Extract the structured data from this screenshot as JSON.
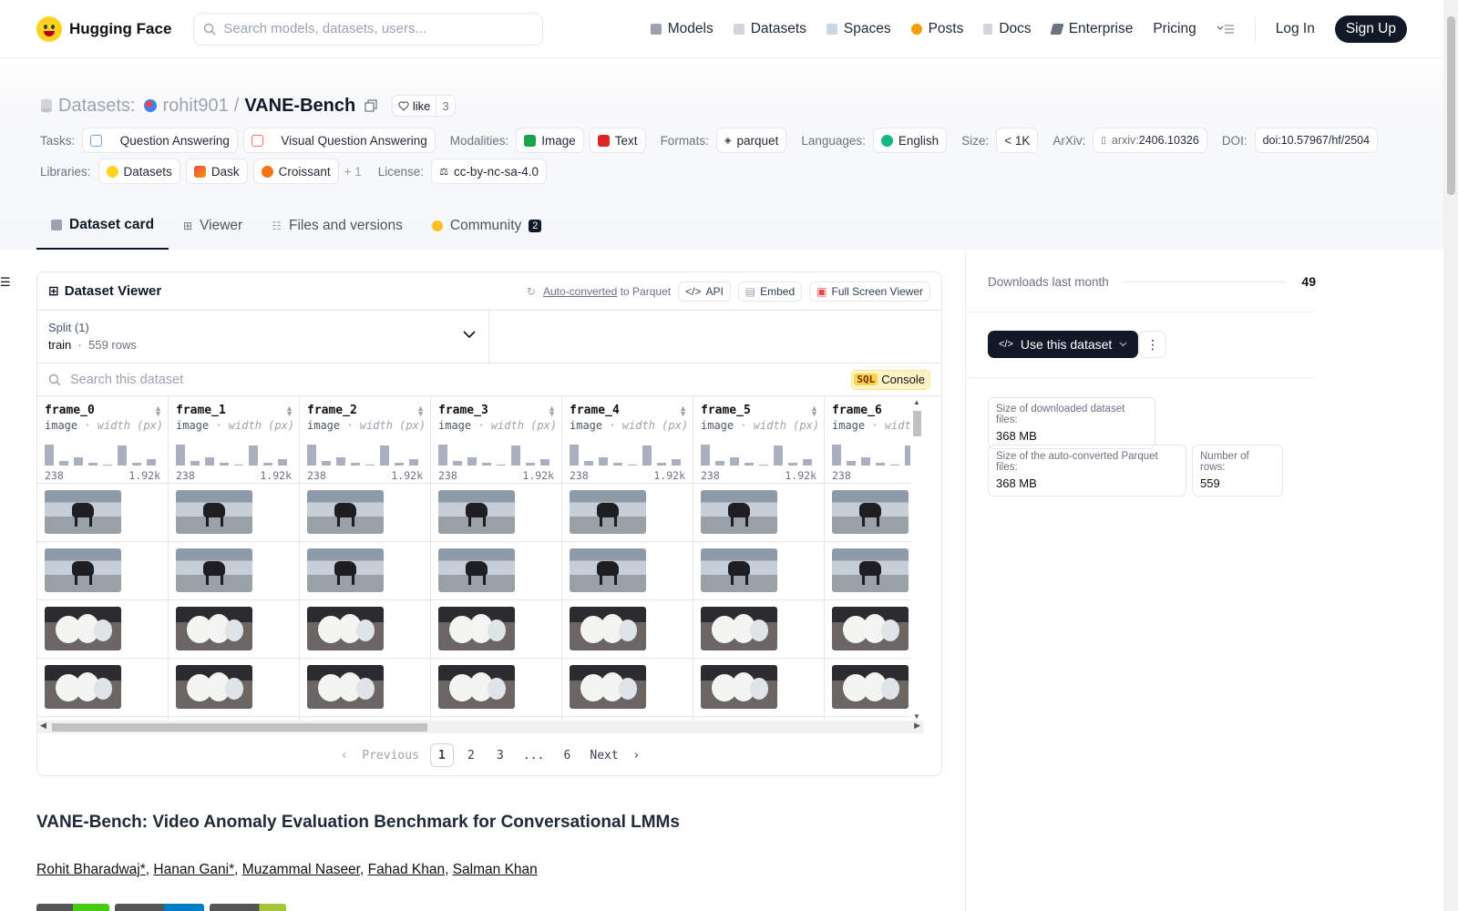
{
  "nav": {
    "brand": "Hugging Face",
    "search_placeholder": "Search models, datasets, users...",
    "links": [
      "Models",
      "Datasets",
      "Spaces",
      "Posts",
      "Docs",
      "Enterprise",
      "Pricing"
    ],
    "login": "Log In",
    "signup": "Sign Up"
  },
  "repo": {
    "type_label": "Datasets:",
    "owner": "rohit901",
    "slash": "/",
    "name": "VANE-Bench",
    "like_label": "like",
    "like_count": "3"
  },
  "tags": {
    "tasks_label": "Tasks:",
    "tasks": [
      "Question Answering",
      "Visual Question Answering"
    ],
    "modalities_label": "Modalities:",
    "modalities": [
      "Image",
      "Text"
    ],
    "formats_label": "Formats:",
    "format": "parquet",
    "languages_label": "Languages:",
    "language": "English",
    "size_label": "Size:",
    "size": "< 1K",
    "arxiv_label": "ArXiv:",
    "arxiv_prefix": "arxiv:",
    "arxiv_id": "2406.10326",
    "doi_label": "DOI:",
    "doi": "doi:10.57967/hf/2504",
    "libraries_label": "Libraries:",
    "libraries": [
      "Datasets",
      "Dask",
      "Croissant"
    ],
    "libraries_more": "+ 1",
    "license_label": "License:",
    "license": "cc-by-nc-sa-4.0"
  },
  "tabs": [
    "Dataset card",
    "Viewer",
    "Files and versions",
    "Community"
  ],
  "community_count": "2",
  "viewer": {
    "title": "Dataset Viewer",
    "auto_converted": "Auto-converted",
    "to_parquet": "to Parquet",
    "api": "API",
    "embed": "Embed",
    "full_screen": "Full Screen Viewer",
    "split_label": "Split (1)",
    "split_name": "train",
    "split_dot": "·",
    "split_rows": "559 rows",
    "search_placeholder": "Search this dataset",
    "sql_badge": "SQL",
    "console": "Console",
    "columns": [
      {
        "name": "frame_0",
        "type": "image",
        "sub": "· width (px)",
        "min": "238",
        "max": "1.92k"
      },
      {
        "name": "frame_1",
        "type": "image",
        "sub": "· width (px)",
        "min": "238",
        "max": "1.92k"
      },
      {
        "name": "frame_2",
        "type": "image",
        "sub": "· width (px)",
        "min": "238",
        "max": "1.92k"
      },
      {
        "name": "frame_3",
        "type": "image",
        "sub": "· width (px)",
        "min": "238",
        "max": "1.92k"
      },
      {
        "name": "frame_4",
        "type": "image",
        "sub": "· width (px)",
        "min": "238",
        "max": "1.92k"
      },
      {
        "name": "frame_5",
        "type": "image",
        "sub": "· width (px)",
        "min": "238",
        "max": "1.92k"
      },
      {
        "name": "frame_6",
        "type": "image",
        "sub": "· width (px)",
        "min": "238",
        "max": ""
      }
    ],
    "histogram": [
      0.9,
      0.2,
      0.35,
      0.1,
      0.0,
      0.85,
      0.1,
      0.25
    ],
    "row_kinds": [
      "dog",
      "dog",
      "pup",
      "pup",
      "dark"
    ],
    "pager": [
      "Previous",
      "1",
      "2",
      "3",
      "...",
      "6",
      "Next"
    ],
    "current_page": "1"
  },
  "article": {
    "title": "VANE-Bench: Video Anomaly Evaluation Benchmark for Conversational LMMs",
    "authors": [
      "Rohit Bharadwaj*",
      "Hanan Gani*",
      "Muzammal Naseer",
      "Fahad Khan",
      "Salman Khan"
    ],
    "author_sep": ","
  },
  "sidebar": {
    "downloads_label": "Downloads last month",
    "downloads_value": "49",
    "use_dataset": "Use this dataset",
    "size_files_label": "Size of downloaded dataset files:",
    "size_files_value": "368 MB",
    "size_parquet_label": "Size of the auto-converted Parquet files:",
    "size_parquet_value": "368 MB",
    "rows_label": "Number of rows:",
    "rows_value": "559"
  },
  "colors": {
    "dark": "#111827",
    "accent_yellow": "#ffd21e",
    "histogram": "#aab0bf"
  }
}
